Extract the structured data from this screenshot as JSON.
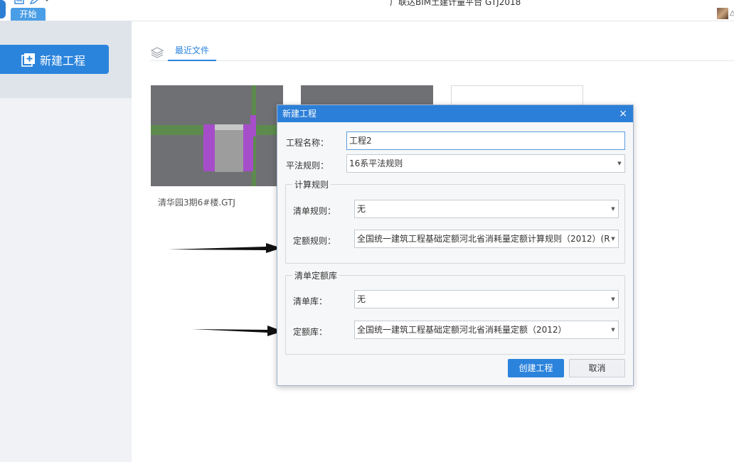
{
  "app": {
    "title": "广联达BIM土建计量平台 GTJ2018",
    "start_tab": "开始"
  },
  "sidebar": {
    "new_project_label": "新建工程"
  },
  "main": {
    "recent_tab": "最近文件",
    "recent_files": [
      {
        "name": "清华园3期6#楼.GTJ"
      }
    ]
  },
  "dialog": {
    "title": "新建工程",
    "close_symbol": "×",
    "project_name_label": "工程名称：",
    "project_name_value": "工程2",
    "rule_label": "平法规则：",
    "rule_value": "16系平法规则",
    "calc_group_title": "计算规则",
    "bill_rule_label": "清单规则：",
    "bill_rule_value": "无",
    "quota_rule_label": "定额规则：",
    "quota_rule_value": "全国统一建筑工程基础定额河北省消耗量定额计算规则（2012）(R:",
    "lib_group_title": "清单定额库",
    "bill_lib_label": "清单库：",
    "bill_lib_value": "无",
    "quota_lib_label": "定额库：",
    "quota_lib_value": "全国统一建筑工程基础定额河北省消耗量定额（2012）",
    "create_button": "创建工程",
    "cancel_button": "取消"
  }
}
